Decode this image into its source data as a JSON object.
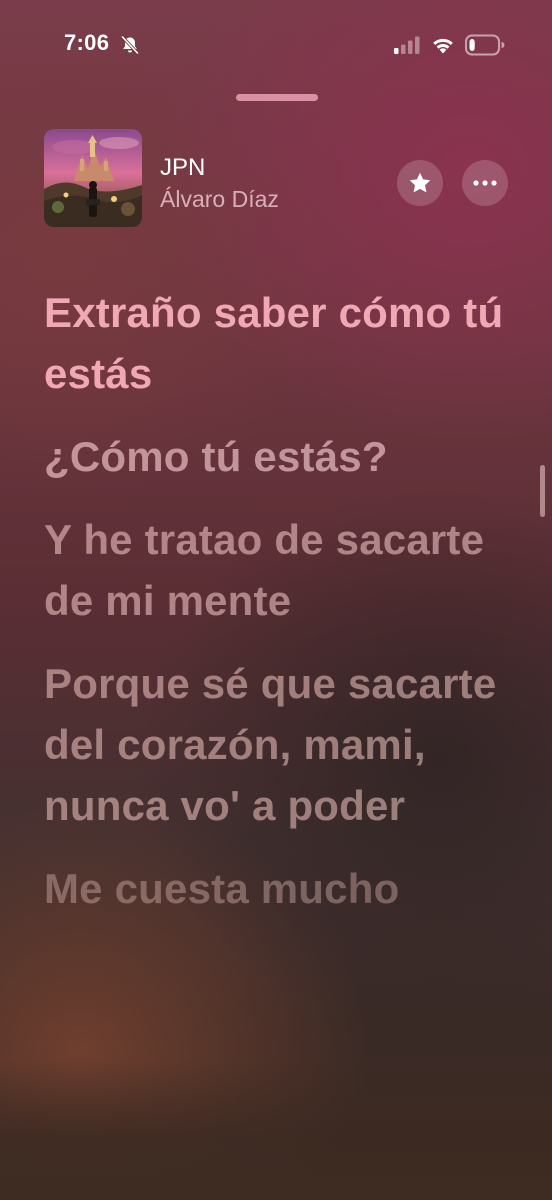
{
  "status_bar": {
    "time": "7:06",
    "bell_icon": "bell-slash-icon",
    "signal_icon": "cellular-signal-icon",
    "wifi_icon": "wifi-icon",
    "battery_icon": "battery-icon",
    "battery_level": 0.2
  },
  "now_playing": {
    "title": "JPN",
    "artist": "Álvaro Díaz",
    "favorite_icon": "star-icon",
    "more_icon": "ellipsis-icon"
  },
  "lyrics": {
    "lines": [
      "Extraño saber cómo tú estás",
      "¿Cómo tú estás?",
      "Y he tratao de sacarte de mi mente",
      "Porque sé que sacarte del corazón, mami, nunca vo' a poder",
      "Me cuesta mucho"
    ],
    "active_index": 0,
    "accent_color": "#f0a9b4"
  }
}
